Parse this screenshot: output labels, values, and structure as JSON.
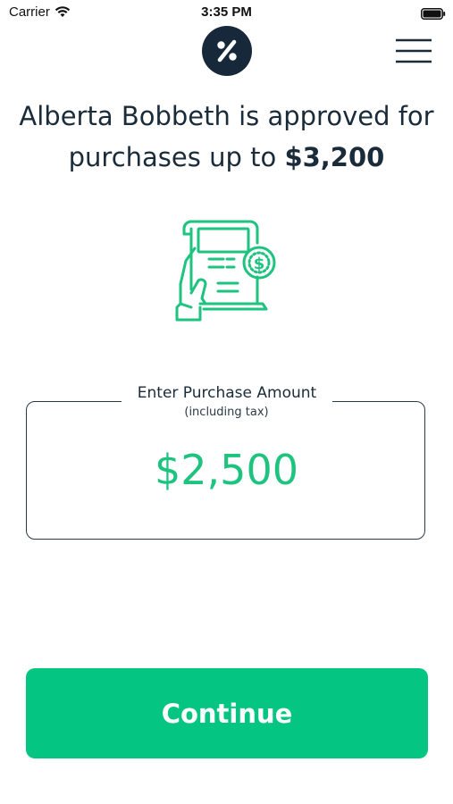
{
  "status_bar": {
    "carrier": "Carrier",
    "time": "3:35 PM",
    "icons": [
      "wifi-icon",
      "battery-icon"
    ]
  },
  "header": {
    "logo_icon": "percent-icon",
    "menu_icon": "hamburger-menu-icon"
  },
  "approval": {
    "line1": "Alberta Bobbeth is approved for",
    "line2_prefix": "purchases up to ",
    "limit": "$3,200"
  },
  "illustration_icon": "receipt-hand-dollar-icon",
  "purchase": {
    "label": "Enter Purchase Amount",
    "sublabel": "(including tax)",
    "value": "$2,500"
  },
  "continue_label": "Continue",
  "colors": {
    "accent": "#05c582",
    "amount_text": "#1ec37f",
    "dark": "#1a2b3a"
  }
}
